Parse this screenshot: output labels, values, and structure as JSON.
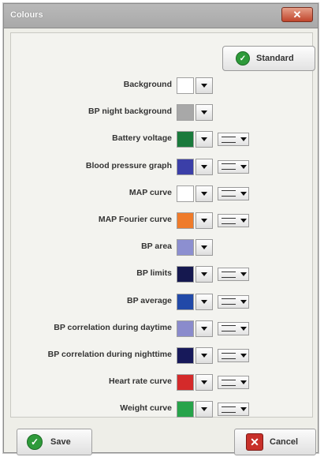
{
  "window": {
    "title": "Colours",
    "close_symbol": "✕"
  },
  "standard_button": {
    "label": "Standard",
    "icon": "green-circle-check-icon",
    "icon_glyph": "✓"
  },
  "colour_rows": [
    {
      "label": "Background",
      "color": "#ffffff",
      "line_style": false
    },
    {
      "label": "BP night background",
      "color": "#a8a8a8",
      "line_style": false
    },
    {
      "label": "Battery voltage",
      "color": "#1a7a3c",
      "line_style": true
    },
    {
      "label": "Blood pressure graph",
      "color": "#3b3fa8",
      "line_style": true
    },
    {
      "label": "MAP curve",
      "color": "#ffffff",
      "line_style": true
    },
    {
      "label": "MAP Fourier curve",
      "color": "#ef7b2a",
      "line_style": true
    },
    {
      "label": "BP area",
      "color": "#8c8fd0",
      "line_style": false
    },
    {
      "label": "BP limits",
      "color": "#15184f",
      "line_style": true
    },
    {
      "label": "BP average",
      "color": "#2149a8",
      "line_style": true
    },
    {
      "label": "BP correlation during daytime",
      "color": "#8a8bcc",
      "line_style": true
    },
    {
      "label": "BP correlation during nighttime",
      "color": "#17195a",
      "line_style": true
    },
    {
      "label": "Heart rate curve",
      "color": "#d42a2a",
      "line_style": true
    },
    {
      "label": "Weight curve",
      "color": "#27a34a",
      "line_style": true
    }
  ],
  "footer": {
    "save_label": "Save",
    "save_icon": "green-check-icon",
    "save_glyph": "✓",
    "cancel_label": "Cancel",
    "cancel_icon": "red-x-icon",
    "cancel_glyph": "✕"
  }
}
